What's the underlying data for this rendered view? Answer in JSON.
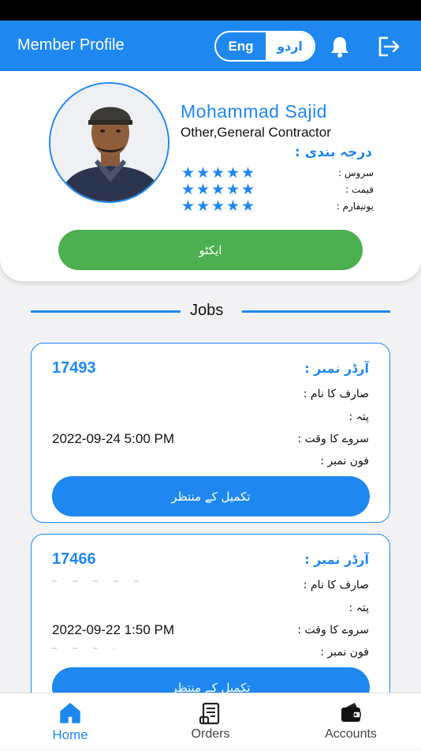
{
  "header": {
    "title": "Member Profile",
    "lang_eng": "Eng",
    "lang_urdu": "اردو",
    "accent": "#1e88f0"
  },
  "profile": {
    "name": "Mohammad Sajid",
    "profession": "Other,General Contractor",
    "rating_title": "درجہ بندی :",
    "ratings": [
      {
        "label": "سروس :",
        "stars": 5
      },
      {
        "label": "قیمت :",
        "stars": 5
      },
      {
        "label": "یونیفارم :",
        "stars": 5
      }
    ],
    "status_button": "ایکٹو",
    "status_color": "#4caf50"
  },
  "jobs_heading": "Jobs",
  "jobs": [
    {
      "order_no": "17493",
      "order_label": "آرڈر نمبر :",
      "customer_label": "صارف کا نام :",
      "address_label": "پتہ :",
      "time_label": "سروے کا وقت :",
      "time_value": "2022-09-24 5:00 PM",
      "phone_label": "فون نمبر :",
      "button": "تکمیل کے منتظر"
    },
    {
      "order_no": "17466",
      "order_label": "آرڈر نمبر :",
      "customer_label": "صارف کا نام :",
      "address_label": "پتہ :",
      "time_label": "سروے کا وقت :",
      "time_value": "2022-09-22 1:50 PM",
      "phone_label": "فون نمبر :",
      "button": "تکمیل کے منتظر"
    }
  ],
  "nav": [
    {
      "label": "Home",
      "icon": "home-icon",
      "active": true
    },
    {
      "label": "Orders",
      "icon": "receipt-icon",
      "active": false
    },
    {
      "label": "Accounts",
      "icon": "wallet-icon",
      "active": false
    }
  ]
}
